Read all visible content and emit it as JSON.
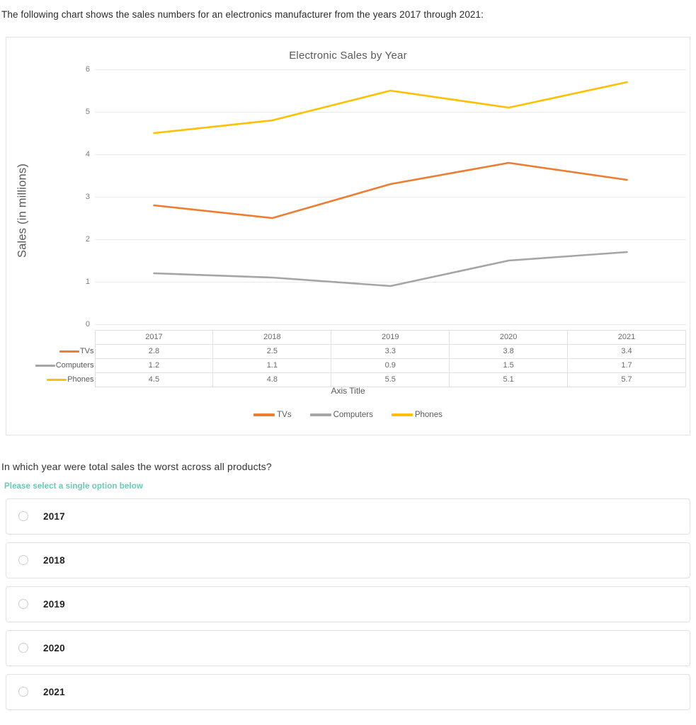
{
  "intro": "The following chart shows the sales numbers for an electronics manufacturer from the years 2017 through 2021:",
  "chart_data": {
    "type": "line",
    "title": "Electronic Sales by Year",
    "xlabel": "Axis Title",
    "ylabel": "Sales (in millions)",
    "categories": [
      "2017",
      "2018",
      "2019",
      "2020",
      "2021"
    ],
    "ylim": [
      0,
      6
    ],
    "yticks": [
      "6",
      "5",
      "4",
      "3",
      "2",
      "1",
      "0"
    ],
    "grid": true,
    "legend_position": "bottom",
    "series": [
      {
        "name": "TVs",
        "color": "#ED7D31",
        "values": [
          2.8,
          2.5,
          3.3,
          3.8,
          3.4
        ]
      },
      {
        "name": "Computers",
        "color": "#A5A5A5",
        "values": [
          1.2,
          1.1,
          0.9,
          1.5,
          1.7
        ]
      },
      {
        "name": "Phones",
        "color": "#FFC000",
        "values": [
          4.5,
          4.8,
          5.5,
          5.1,
          5.7
        ]
      }
    ],
    "data_table": {
      "corner": "",
      "columns": [
        "2017",
        "2018",
        "2019",
        "2020",
        "2021"
      ],
      "rows": [
        {
          "label": "TVs",
          "color": "#ED7D31",
          "values": [
            "2.8",
            "2.5",
            "3.3",
            "3.8",
            "3.4"
          ]
        },
        {
          "label": "Computers",
          "color": "#A5A5A5",
          "values": [
            "1.2",
            "1.1",
            "0.9",
            "1.5",
            "1.7"
          ]
        },
        {
          "label": "Phones",
          "color": "#FFC000",
          "values": [
            "4.5",
            "4.8",
            "5.5",
            "5.1",
            "5.7"
          ]
        }
      ]
    }
  },
  "question": {
    "text": "In which year were total sales the worst across all products?",
    "hint": "Please select a single option below",
    "hint_color": "#6ec6b5",
    "options": [
      {
        "label": "2017",
        "selected": false
      },
      {
        "label": "2018",
        "selected": false
      },
      {
        "label": "2019",
        "selected": false
      },
      {
        "label": "2020",
        "selected": false
      },
      {
        "label": "2021",
        "selected": false
      }
    ]
  }
}
